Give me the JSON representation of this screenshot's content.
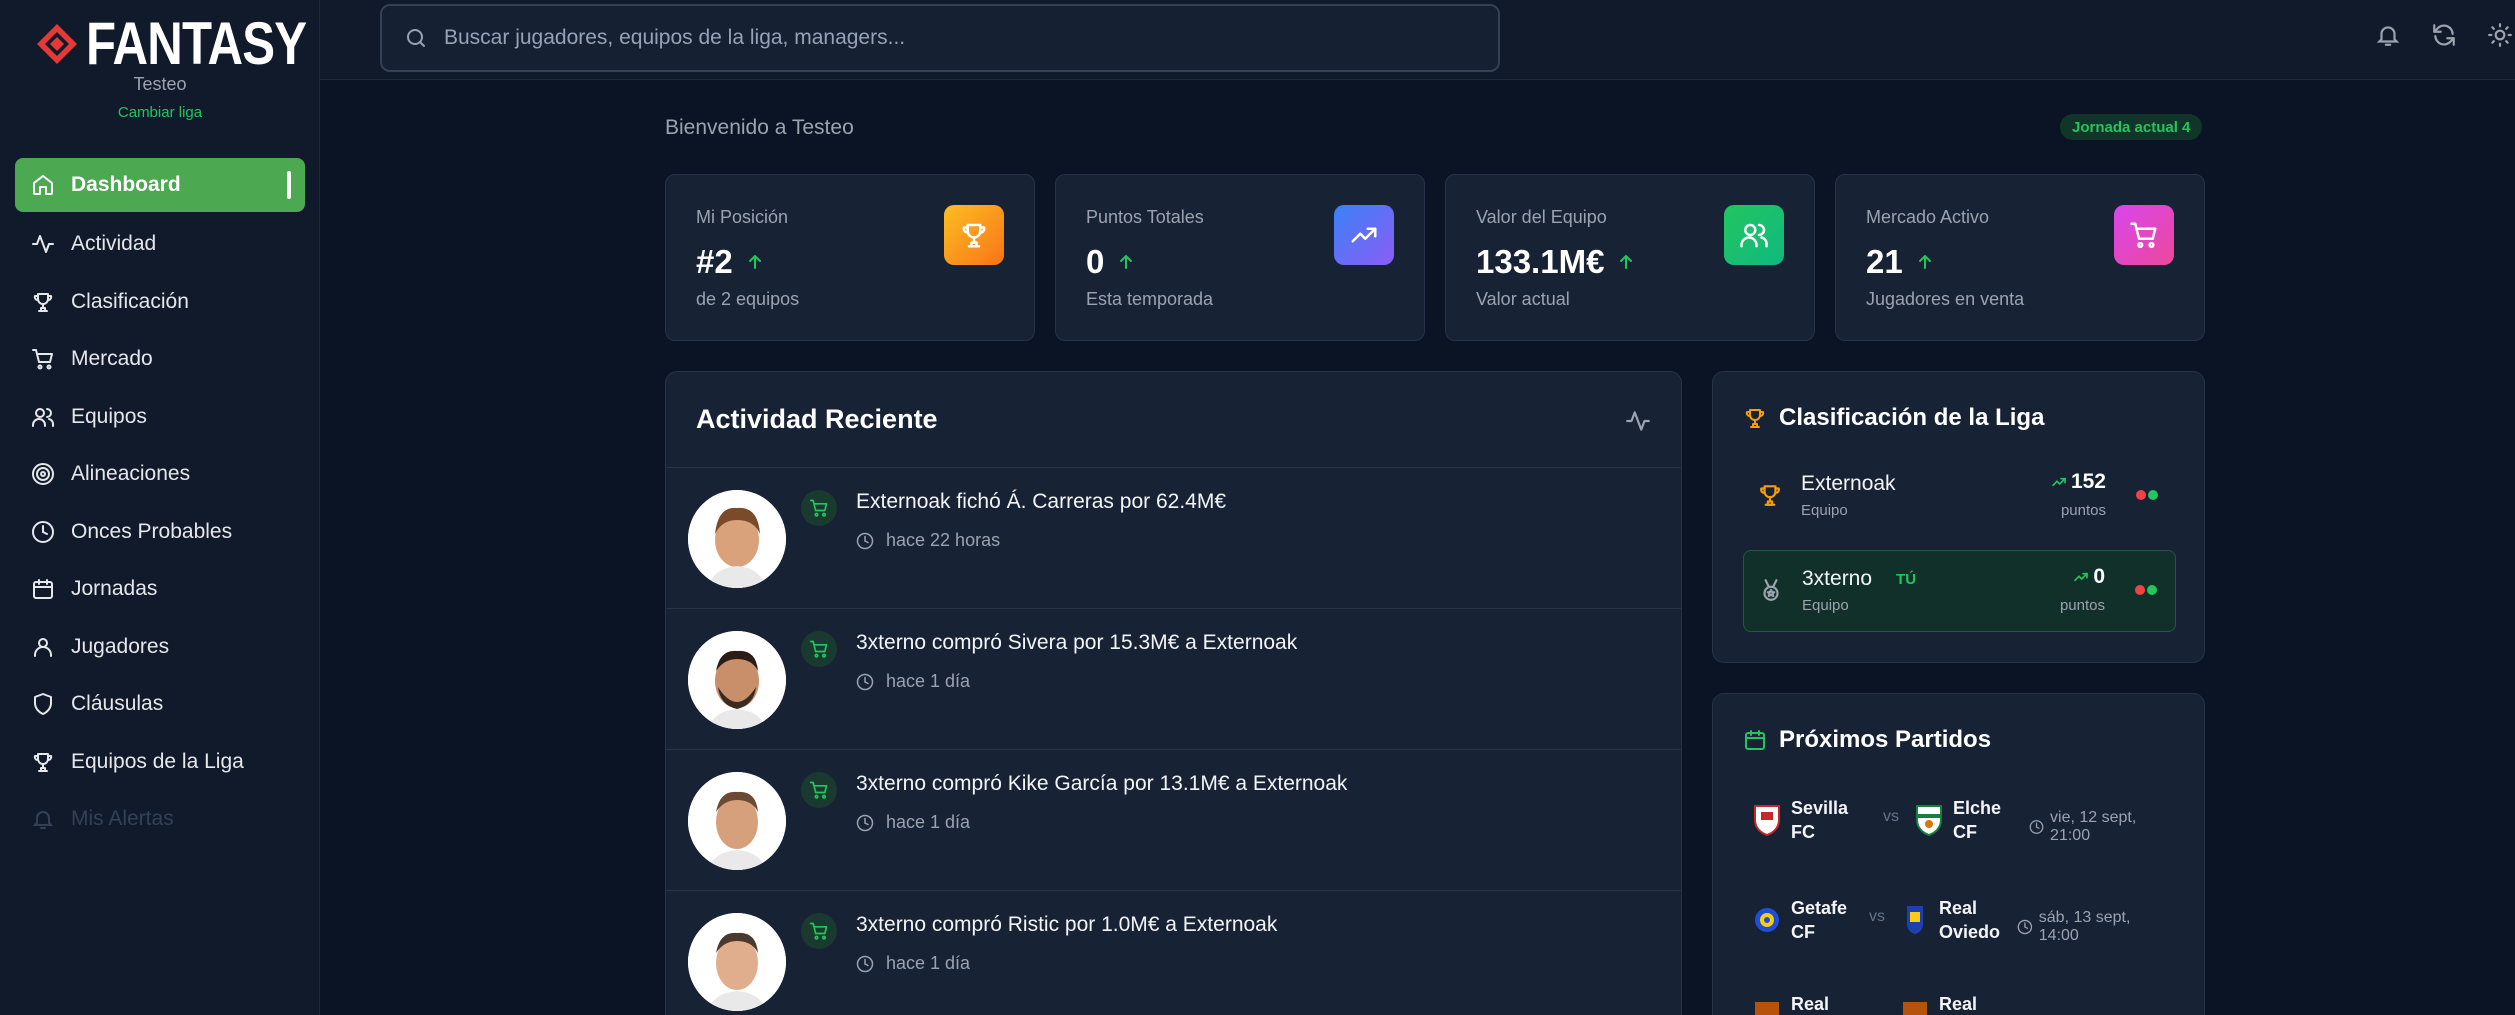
{
  "app": {
    "brand": "FANTASY",
    "league_name": "Testeo",
    "change_league": "Cambiar liga"
  },
  "sidebar": {
    "items": [
      {
        "label": "Dashboard",
        "icon": "home-icon",
        "active": true
      },
      {
        "label": "Actividad",
        "icon": "activity-icon"
      },
      {
        "label": "Clasificación",
        "icon": "trophy-icon"
      },
      {
        "label": "Mercado",
        "icon": "cart-icon"
      },
      {
        "label": "Equipos",
        "icon": "users-icon"
      },
      {
        "label": "Alineaciones",
        "icon": "target-icon"
      },
      {
        "label": "Onces Probables",
        "icon": "clock-icon"
      },
      {
        "label": "Jornadas",
        "icon": "calendar-icon"
      },
      {
        "label": "Jugadores",
        "icon": "user-icon"
      },
      {
        "label": "Cláusulas",
        "icon": "shield-icon"
      },
      {
        "label": "Equipos de la Liga",
        "icon": "trophy-icon"
      },
      {
        "label": "Mis Alertas",
        "icon": "bell-icon",
        "disabled": true
      }
    ]
  },
  "topbar": {
    "search_placeholder": "Buscar jugadores, equipos de la liga, managers...",
    "icons": [
      "bell-icon",
      "refresh-icon",
      "sun-icon"
    ]
  },
  "main": {
    "welcome": "Bienvenido a Testeo",
    "round_badge": "Jornada actual 4",
    "stats": [
      {
        "label": "Mi Posición",
        "value": "#2",
        "sub": "de 2 equipos",
        "icon": "trophy-icon",
        "color": "#f59e0b"
      },
      {
        "label": "Puntos Totales",
        "value": "0",
        "sub": "Esta temporada",
        "icon": "trending-up-icon",
        "color": "#6366f1"
      },
      {
        "label": "Valor del Equipo",
        "value": "133.1M€",
        "sub": "Valor actual",
        "icon": "users-icon",
        "color": "#22c55e"
      },
      {
        "label": "Mercado Activo",
        "value": "21",
        "sub": "Jugadores en venta",
        "icon": "cart-icon",
        "color": "#d946ef"
      }
    ]
  },
  "activity": {
    "title": "Actividad Reciente",
    "items": [
      {
        "text": "Externoak fichó Á. Carreras por 62.4M€",
        "time": "hace 22 horas"
      },
      {
        "text": "3xterno compró Sivera por 15.3M€ a Externoak",
        "time": "hace 1 día"
      },
      {
        "text": "3xterno compró Kike García por 13.1M€ a Externoak",
        "time": "hace 1 día"
      },
      {
        "text": "3xterno compró Ristic por 1.0M€ a Externoak",
        "time": "hace 1 día"
      }
    ]
  },
  "league": {
    "title": "Clasificación de la Liga",
    "teams": [
      {
        "name": "Externoak",
        "sub": "Equipo",
        "points": "152",
        "points_label": "puntos",
        "me": false
      },
      {
        "name": "3xterno",
        "tag": "TÚ",
        "sub": "Equipo",
        "points": "0",
        "points_label": "puntos",
        "me": true
      }
    ]
  },
  "matches": {
    "title": "Próximos Partidos",
    "vs": "vs",
    "items": [
      {
        "home": "Sevilla FC",
        "away": "Elche CF",
        "date": "vie, 12 sept, 21:00"
      },
      {
        "home": "Getafe CF",
        "away": "Real Oviedo",
        "date": "sáb, 13 sept, 14:00"
      },
      {
        "home": "Real",
        "away": "Real",
        "date": ""
      }
    ]
  }
}
